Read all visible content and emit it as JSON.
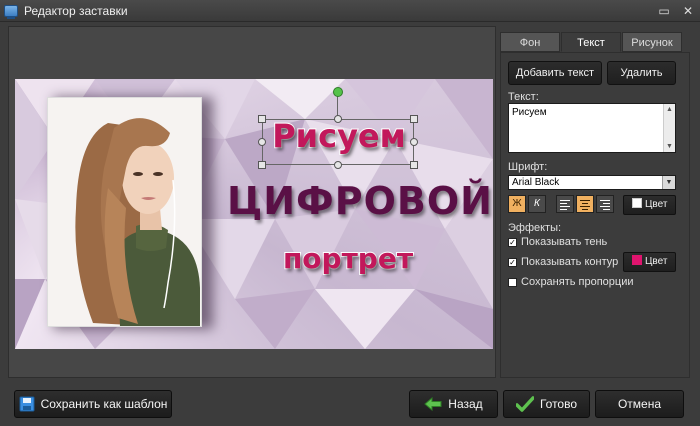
{
  "window": {
    "title": "Редактор заставки",
    "controls": [
      "▭",
      "✕"
    ]
  },
  "canvas": {
    "lines": [
      "Рисуем",
      "ЦИФРОВОЙ",
      "портрет"
    ],
    "colors": {
      "accent": "#c2185b",
      "dark": "#5a1046"
    }
  },
  "panel": {
    "tabs": [
      "Фон",
      "Текст",
      "Рисунок"
    ],
    "active_tab": "Текст",
    "add_text": "Добавить текст",
    "delete": "Удалить",
    "text_label": "Текст:",
    "text_value": "Рисуем",
    "font_label": "Шрифт:",
    "font_value": "Arial Black",
    "bold": "Ж",
    "italic": "К",
    "color_label": "Цвет",
    "effects_label": "Эффекты:",
    "effects": [
      {
        "label": "Показывать тень",
        "checked": true
      },
      {
        "label": "Показывать контур",
        "checked": true
      },
      {
        "label": "Сохранять пропорции",
        "checked": false
      }
    ],
    "outline_color_label": "Цвет",
    "text_color": "#ffffff",
    "outline_color": "#e0146e"
  },
  "footer": {
    "save_template": "Сохранить как шаблон",
    "back": "Назад",
    "done": "Готово",
    "cancel": "Отмена"
  }
}
